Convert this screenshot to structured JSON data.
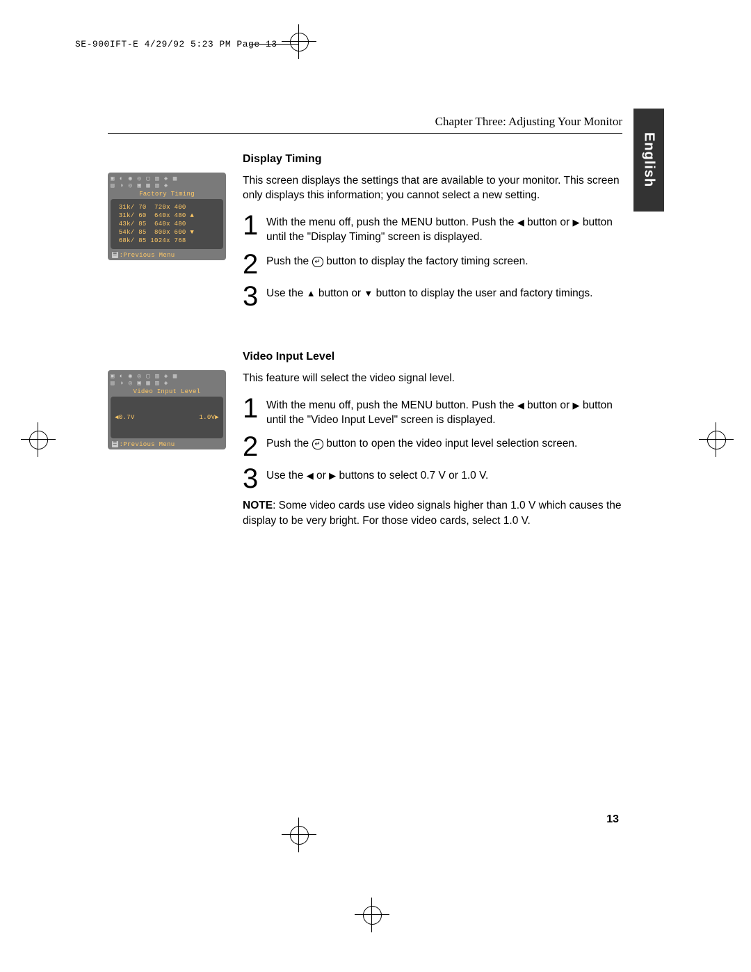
{
  "crop_header": "SE-900IFT-E  4/29/92 5:23 PM  Page 13",
  "chapter_title": "Chapter Three: Adjusting Your Monitor",
  "language_tab": "English",
  "page_number": "13",
  "sections": {
    "display_timing": {
      "title": "Display Timing",
      "intro": "This screen displays the settings that are available to your monitor. This screen only displays this information; you cannot select a new setting.",
      "steps": {
        "s1": "With the menu off, push the MENU button. Push the ◀ button or ▶ button until the \"Display Timing\" screen is displayed.",
        "s2": "Push the ↵ button to display the factory timing screen.",
        "s3": "Use the ▲ button or ▼ button to display the user and factory timings."
      },
      "osd": {
        "title": "Factory Timing",
        "rows": " 31k/ 70  720x 400\n 31k/ 60  640x 480 ▲\n 43k/ 85  640x 480\n 54k/ 85  800x 600 ▼\n 68k/ 85 1024x 768",
        "footer": ":Previous Menu"
      }
    },
    "video_input": {
      "title": "Video Input Level",
      "intro": "This feature will select the video signal level.",
      "steps": {
        "s1": "With the menu off, push the MENU button. Push the ◀ button or ▶ button until the \"Video Input Level\" screen is displayed.",
        "s2": "Push the ↵ button to open the video input level selection screen.",
        "s3": "Use the ◀ or ▶ buttons to select 0.7 V or 1.0 V."
      },
      "note_label": "NOTE",
      "note_text": ": Some video cards use video signals higher than 1.0 V which causes the display to be very bright. For those video cards, select 1.0 V.",
      "osd": {
        "title": "Video Input Level",
        "left": "◀0.7V",
        "right": "1.0V▶",
        "footer": ":Previous Menu"
      }
    }
  }
}
